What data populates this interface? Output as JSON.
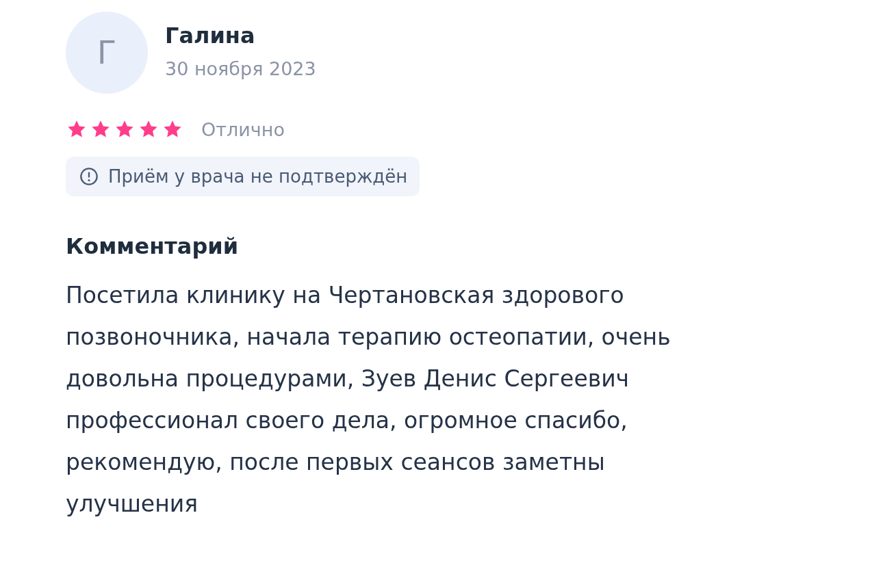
{
  "review": {
    "avatar_letter": "Г",
    "author": "Галина",
    "date": "30 ноября 2023",
    "stars": 5,
    "rating_label": "Отлично",
    "notice": "Приём у врача не подтверждён",
    "comment_heading": "Комментарий",
    "comment": "Посетила клинику на Чертановская здорового позвоночника, начала терапию остеопатии, очень довольна процедурами, Зуев Денис Сергеевич профессионал своего дела, огромное спасибо, рекомендую, после первых сеансов заметны улучшения"
  }
}
